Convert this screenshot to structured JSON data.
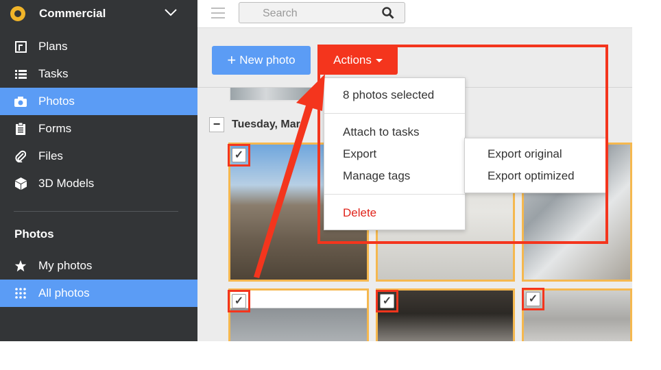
{
  "sidebar": {
    "app_title": "Commercial",
    "nav": [
      {
        "label": "Plans",
        "icon": "plans-icon"
      },
      {
        "label": "Tasks",
        "icon": "list-icon"
      },
      {
        "label": "Photos",
        "icon": "camera-icon"
      },
      {
        "label": "Forms",
        "icon": "clipboard-icon"
      },
      {
        "label": "Files",
        "icon": "paperclip-icon"
      },
      {
        "label": "3D Models",
        "icon": "cube-icon"
      }
    ],
    "section_title": "Photos",
    "sub_nav": [
      {
        "label": "My photos",
        "icon": "star-icon"
      },
      {
        "label": "All photos",
        "icon": "grid-icon"
      }
    ],
    "active_nav": "Photos",
    "active_sub_nav": "All photos"
  },
  "topbar": {
    "search_placeholder": "Search"
  },
  "toolbar": {
    "new_photo_label": "New photo",
    "actions_label": "Actions"
  },
  "content": {
    "date_label": "Tuesday, Mar"
  },
  "actions_menu": {
    "selected_count": "8 photos selected",
    "items": [
      "Attach to tasks",
      "Export",
      "Manage tags"
    ],
    "delete_label": "Delete"
  },
  "export_submenu": {
    "items": [
      "Export original",
      "Export optimized"
    ]
  },
  "colors": {
    "sidebar_bg": "#333537",
    "accent_blue": "#5b9cf5",
    "actions_red": "#f4351d",
    "delete_red": "#e0241b",
    "selection_orange": "#f5b84f"
  }
}
